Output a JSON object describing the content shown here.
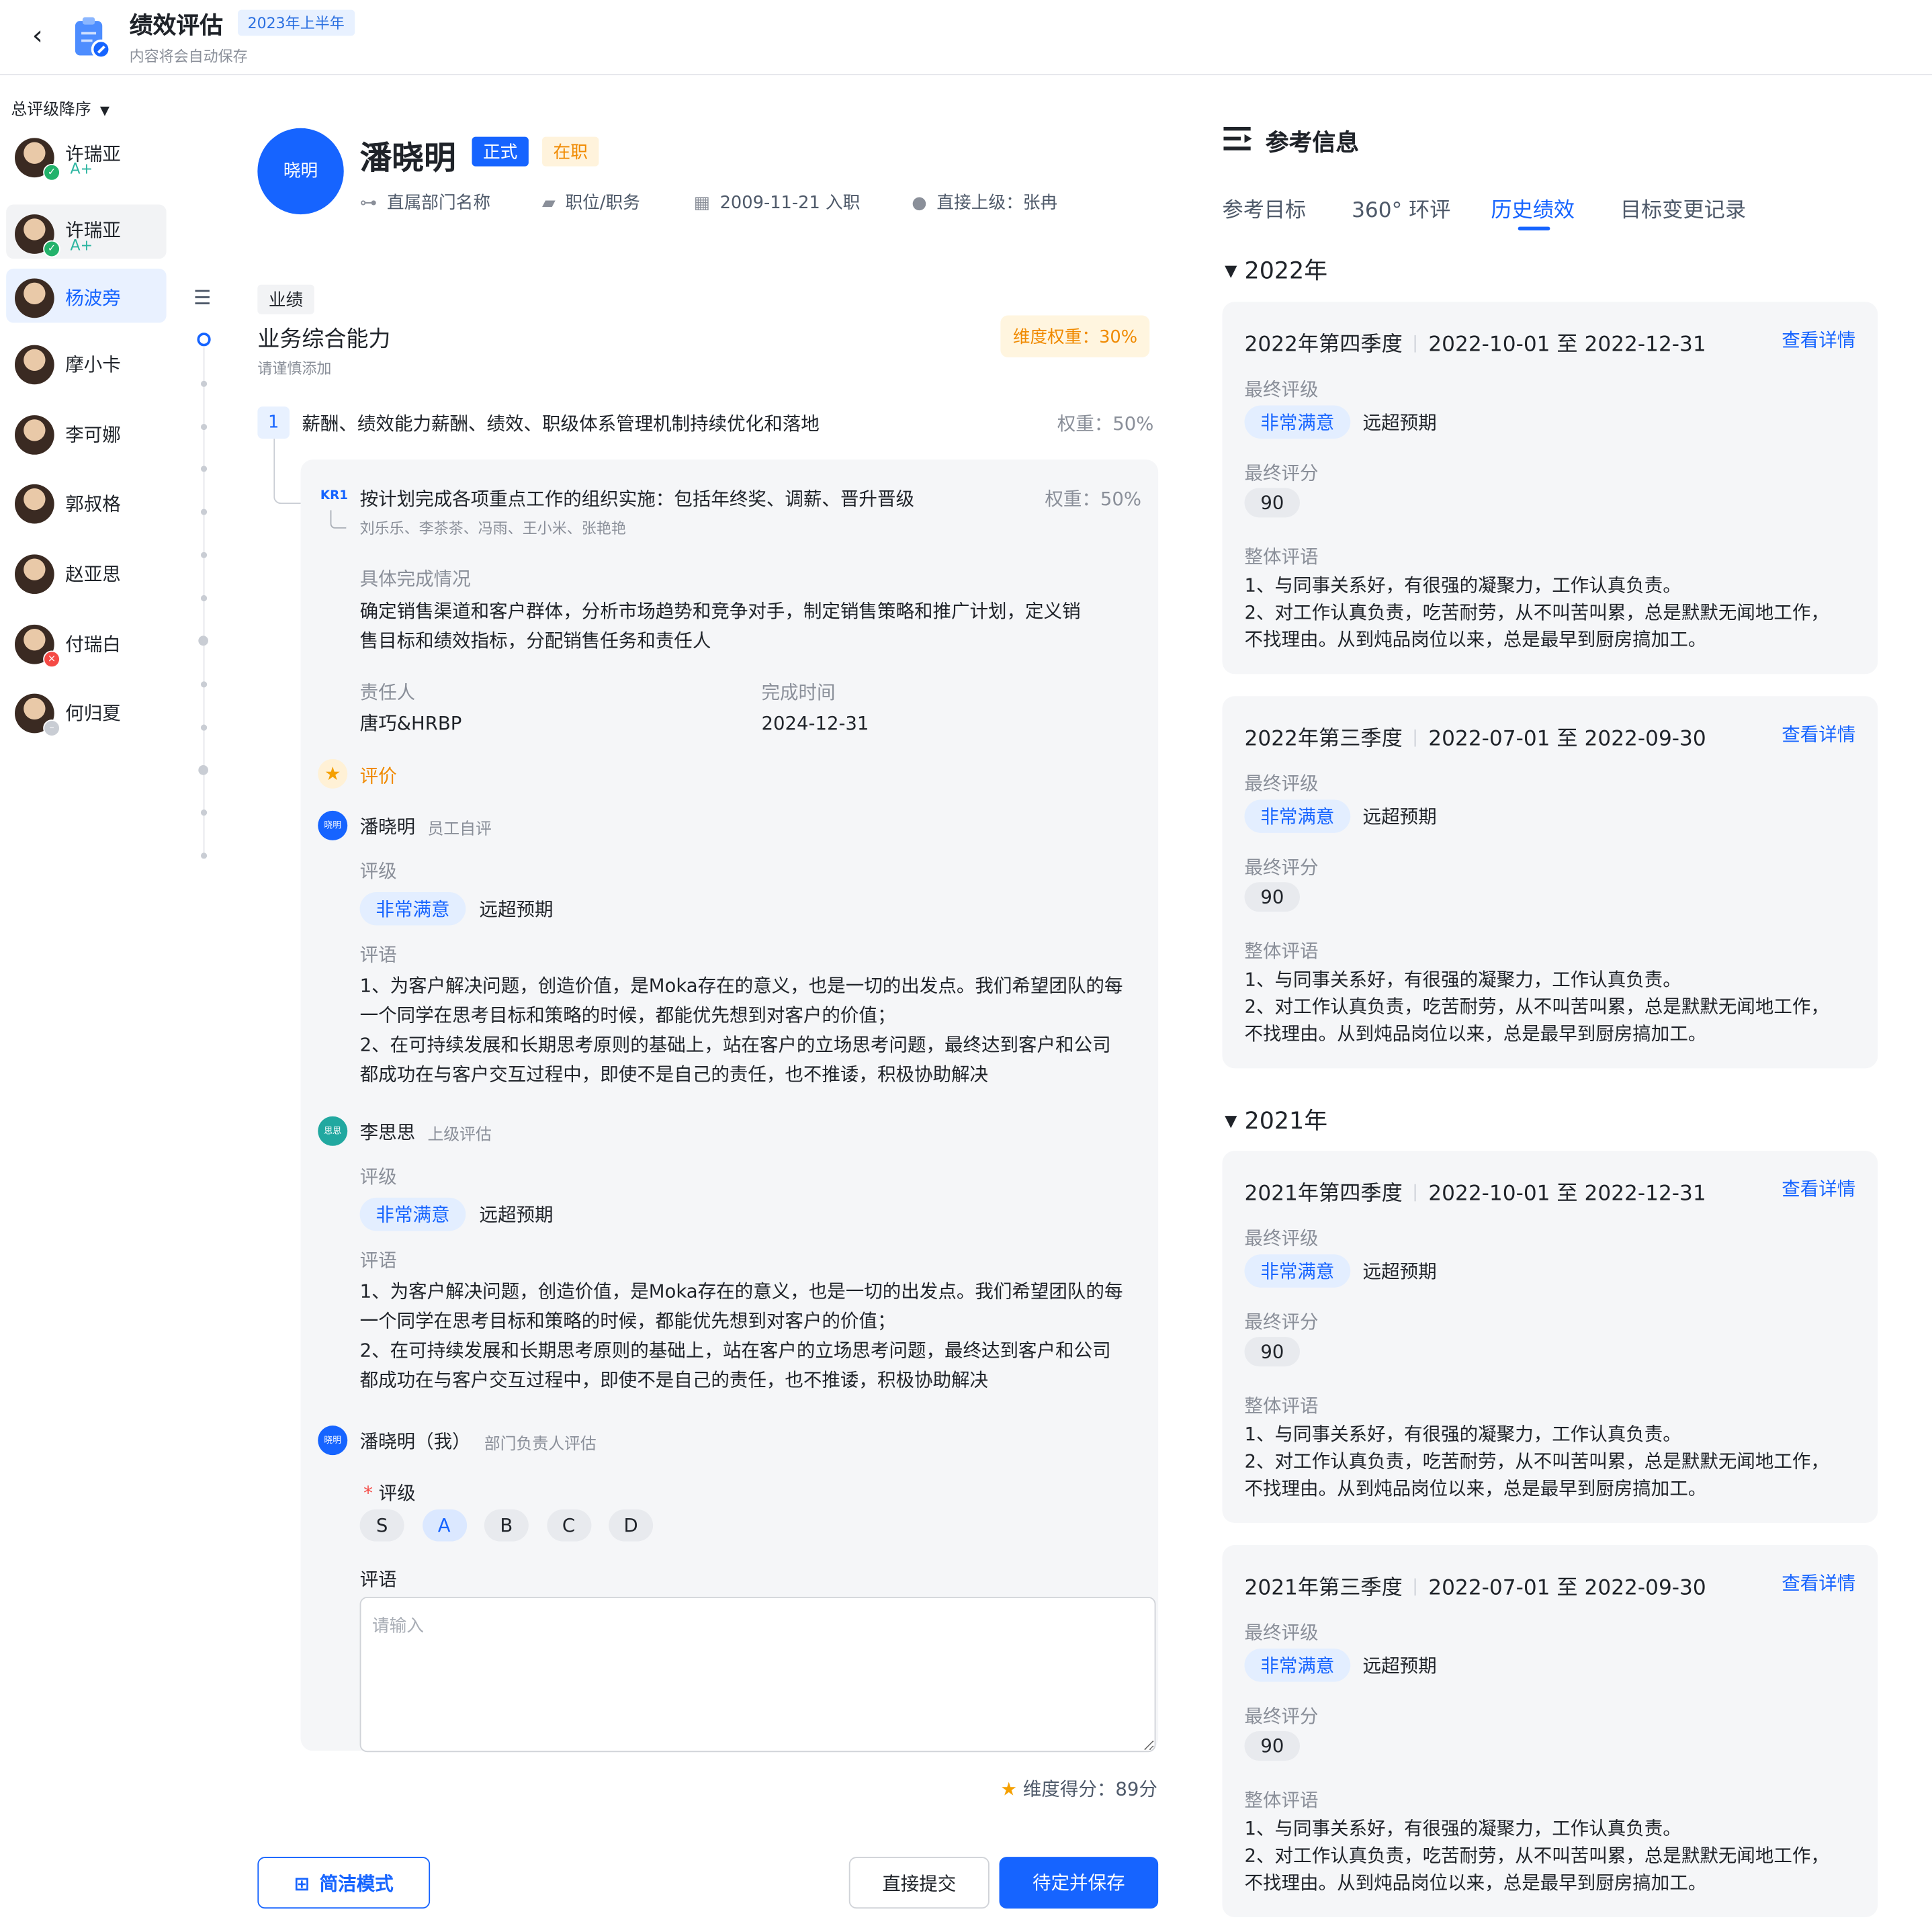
{
  "header": {
    "title": "绩效评估",
    "period_badge": "2023年上半年",
    "autosave_hint": "内容将会自动保存"
  },
  "sidebar": {
    "sort_label": "总评级降序",
    "employees": [
      {
        "name": "许瑞亚",
        "grade": "A+",
        "status": "done"
      },
      {
        "name": "许瑞亚",
        "grade": "A+",
        "status": "done"
      },
      {
        "name": "杨波旁",
        "grade": "",
        "status": ""
      },
      {
        "name": "摩小卡",
        "grade": "",
        "status": ""
      },
      {
        "name": "李可娜",
        "grade": "",
        "status": ""
      },
      {
        "name": "郭叔格",
        "grade": "",
        "status": ""
      },
      {
        "name": "赵亚思",
        "grade": "",
        "status": ""
      },
      {
        "name": "付瑞白",
        "grade": "",
        "status": "rejected"
      },
      {
        "name": "何归夏",
        "grade": "",
        "status": "pending"
      }
    ],
    "selected_index": 2
  },
  "profile": {
    "avatar_text": "晓明",
    "name": "潘晓明",
    "tag_type": "正式",
    "tag_status": "在职",
    "department": "直属部门名称",
    "position": "职位/职务",
    "join_date": "2009-11-21 入职",
    "manager": "直接上级：张冉"
  },
  "dimension": {
    "category_tag": "业绩",
    "title": "业务综合能力",
    "hint": "请谨慎添加",
    "weight": "维度权重：30%",
    "goal": {
      "number": "1",
      "text": "薪酬、绩效能力薪酬、绩效、职级体系管理机制持续优化和落地",
      "weight": "权重：50%"
    },
    "kr": {
      "badge": "KR1",
      "text": "按计划完成各项重点工作的组织实施：包括年终奖、调薪、晋升晋级",
      "weight": "权重：50%",
      "people": "刘乐乐、李茶茶、冯雨、王小米、张艳艳",
      "completion_label": "具体完成情况",
      "completion_lines": [
        "确定销售渠道和客户群体，分析市场趋势和竞争对手，制定销售策略和推广计划，定义销",
        "售目标和绩效指标，分配销售任务和责任人"
      ],
      "owner_label": "责任人",
      "owner": "唐巧&HRBP",
      "due_label": "完成时间",
      "due": "2024-12-31"
    },
    "evaluation": {
      "title": "评价",
      "grade_label": "评级",
      "comment_label": "评语",
      "reviews": [
        {
          "avatar": "晓明",
          "name": "潘晓明",
          "role": "员工自评",
          "grade": "非常满意",
          "grade_desc": "远超预期",
          "comment_lines": [
            "1、为客户解决问题，创造价值，是Moka存在的意义，也是一切的出发点。我们希望团队的每",
            "一个同学在思考目标和策略的时候，都能优先想到对客户的价值；",
            "2、在可持续发展和长期思考原则的基础上，站在客户的立场思考问题，最终达到客户和公司",
            "都成功在与客户交互过程中，即使不是自己的责任，也不推诿，积极协助解决"
          ]
        },
        {
          "avatar": "思思",
          "name": "李思思",
          "role": "上级评估",
          "grade": "非常满意",
          "grade_desc": "远超预期",
          "comment_lines": [
            "1、为客户解决问题，创造价值，是Moka存在的意义，也是一切的出发点。我们希望团队的每",
            "一个同学在思考目标和策略的时候，都能优先想到对客户的价值；",
            "2、在可持续发展和长期思考原则的基础上，站在客户的立场思考问题，最终达到客户和公司",
            "都成功在与客户交互过程中，即使不是自己的责任，也不推诿，积极协助解决"
          ]
        }
      ],
      "my_review": {
        "avatar": "晓明",
        "name": "潘晓明（我）",
        "role": "部门负责人评估",
        "required_mark": "*",
        "grade_label": "评级",
        "options": [
          "S",
          "A",
          "B",
          "C",
          "D"
        ],
        "selected": "A",
        "comment_label": "评语",
        "comment_placeholder": "请输入",
        "comment_value": ""
      }
    },
    "score": "维度得分：89分"
  },
  "actions": {
    "simple_mode": "简洁模式",
    "submit": "直接提交",
    "save": "待定并保存"
  },
  "reference": {
    "title": "参考信息",
    "tabs": [
      "参考目标",
      "360° 环评",
      "历史绩效",
      "目标变更记录"
    ],
    "active_tab": "历史绩效",
    "years": [
      {
        "year": "2022年",
        "cards": [
          {
            "period": "2022年第四季度",
            "range": "2022-10-01 至 2022-12-31",
            "link": "查看详情",
            "grade_label": "最终评级",
            "grade": "非常满意",
            "grade_desc": "远超预期",
            "score_label": "最终评分",
            "score": "90",
            "comment_label": "整体评语",
            "comment_lines": [
              "1、与同事关系好，有很强的凝聚力，工作认真负责。",
              "2、对工作认真负责，吃苦耐劳，从不叫苦叫累，总是默默无闻地工作，",
              "不找理由。从到炖品岗位以来，总是最早到厨房搞加工。"
            ]
          },
          {
            "period": "2022年第三季度",
            "range": "2022-07-01 至 2022-09-30",
            "link": "查看详情",
            "grade_label": "最终评级",
            "grade": "非常满意",
            "grade_desc": "远超预期",
            "score_label": "最终评分",
            "score": "90",
            "comment_label": "整体评语",
            "comment_lines": [
              "1、与同事关系好，有很强的凝聚力，工作认真负责。",
              "2、对工作认真负责，吃苦耐劳，从不叫苦叫累，总是默默无闻地工作，",
              "不找理由。从到炖品岗位以来，总是最早到厨房搞加工。"
            ]
          }
        ]
      },
      {
        "year": "2021年",
        "cards": [
          {
            "period": "2021年第四季度",
            "range": "2022-10-01 至 2022-12-31",
            "link": "查看详情",
            "grade_label": "最终评级",
            "grade": "非常满意",
            "grade_desc": "远超预期",
            "score_label": "最终评分",
            "score": "90",
            "comment_label": "整体评语",
            "comment_lines": [
              "1、与同事关系好，有很强的凝聚力，工作认真负责。",
              "2、对工作认真负责，吃苦耐劳，从不叫苦叫累，总是默默无闻地工作，",
              "不找理由。从到炖品岗位以来，总是最早到厨房搞加工。"
            ]
          },
          {
            "period": "2021年第三季度",
            "range": "2022-07-01 至 2022-09-30",
            "link": "查看详情",
            "grade_label": "最终评级",
            "grade": "非常满意",
            "grade_desc": "远超预期",
            "score_label": "最终评分",
            "score": "90",
            "comment_label": "整体评语",
            "comment_lines": [
              "1、与同事关系好，有很强的凝聚力，工作认真负责。",
              "2、对工作认真负责，吃苦耐劳，从不叫苦叫累，总是默默无闻地工作，",
              "不找理由。从到炖品岗位以来，总是最早到厨房搞加工。"
            ]
          }
        ]
      }
    ]
  },
  "colors": {
    "primary": "#1664ff",
    "warning": "#f08a00",
    "success": "#2bb5a0"
  }
}
